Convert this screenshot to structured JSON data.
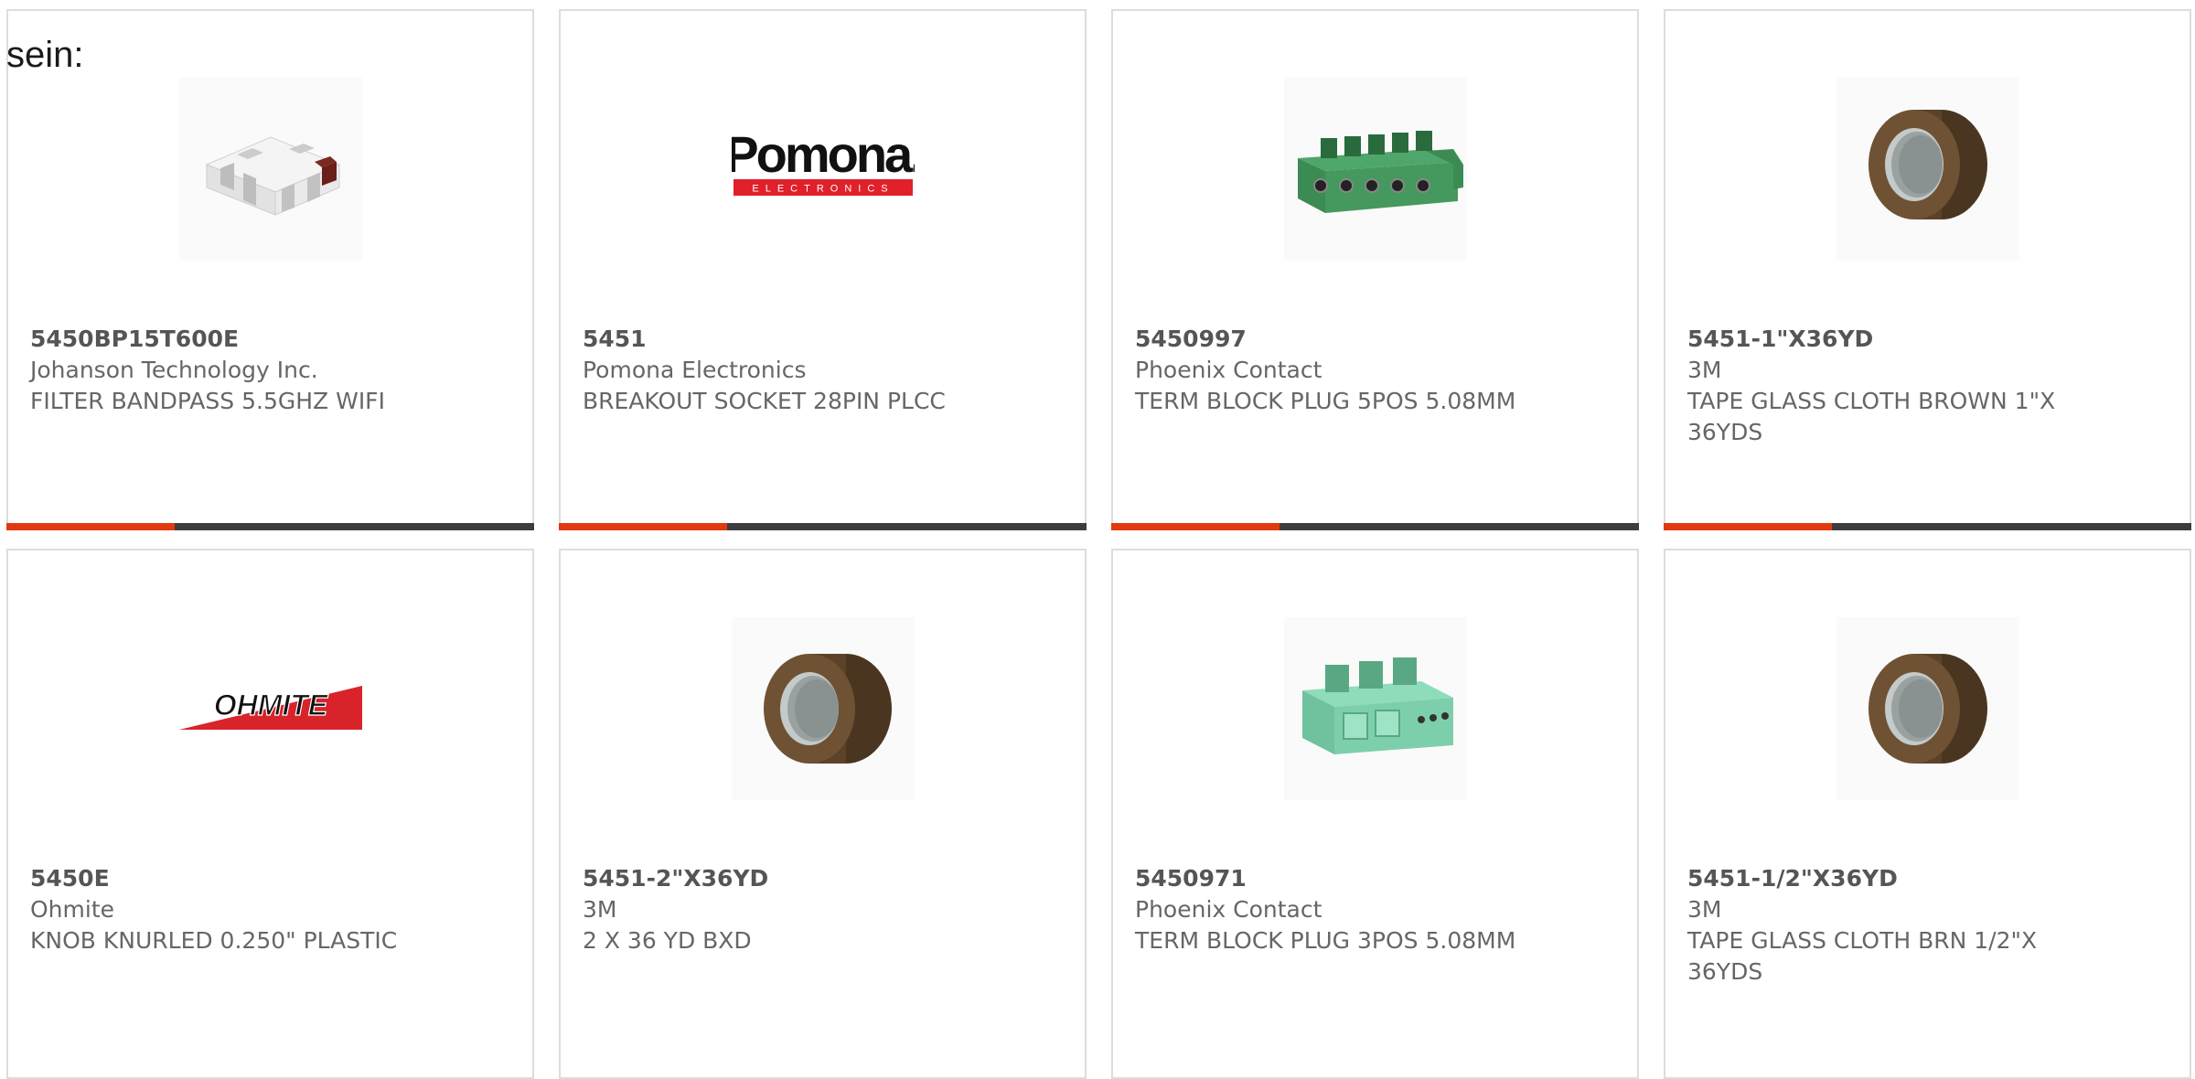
{
  "page": {
    "label": "sein:"
  },
  "colors": {
    "accent": "#e03a0e",
    "bar_dark": "#3d3d3d",
    "card_border": "#dddddd",
    "text_muted": "#666666"
  },
  "products": [
    {
      "part_number": "5450BP15T600E",
      "manufacturer": "Johanson Technology Inc.",
      "description": "FILTER BANDPASS 5.5GHZ WIFI",
      "image_icon": "chip-filter-icon",
      "show_bar": true
    },
    {
      "part_number": "5451",
      "manufacturer": "Pomona Electronics",
      "description": "BREAKOUT SOCKET 28PIN PLCC",
      "image_icon": "pomona-logo",
      "logo_text": "Pomona.",
      "logo_subtext": "ELECTRONICS",
      "show_bar": true
    },
    {
      "part_number": "5450997",
      "manufacturer": "Phoenix Contact",
      "description": "TERM BLOCK PLUG 5POS 5.08MM",
      "image_icon": "terminal-block-5pos-icon",
      "show_bar": true
    },
    {
      "part_number": "5451-1\"X36YD",
      "manufacturer": "3M",
      "description": "TAPE GLASS CLOTH BROWN 1\"X 36YDS",
      "image_icon": "tape-roll-icon",
      "show_bar": true
    },
    {
      "part_number": "5450E",
      "manufacturer": "Ohmite",
      "description": "KNOB KNURLED 0.250\" PLASTIC",
      "image_icon": "ohmite-logo",
      "logo_text": "OHMITE",
      "show_bar": false
    },
    {
      "part_number": "5451-2\"X36YD",
      "manufacturer": "3M",
      "description": "2 X 36 YD BXD",
      "image_icon": "tape-roll-icon",
      "show_bar": false
    },
    {
      "part_number": "5450971",
      "manufacturer": "Phoenix Contact",
      "description": "TERM BLOCK PLUG 3POS 5.08MM",
      "image_icon": "terminal-block-3pos-icon",
      "show_bar": false
    },
    {
      "part_number": "5451-1/2\"X36YD",
      "manufacturer": "3M",
      "description": "TAPE GLASS CLOTH BRN 1/2\"X 36YDS",
      "image_icon": "tape-roll-icon",
      "show_bar": false
    }
  ]
}
